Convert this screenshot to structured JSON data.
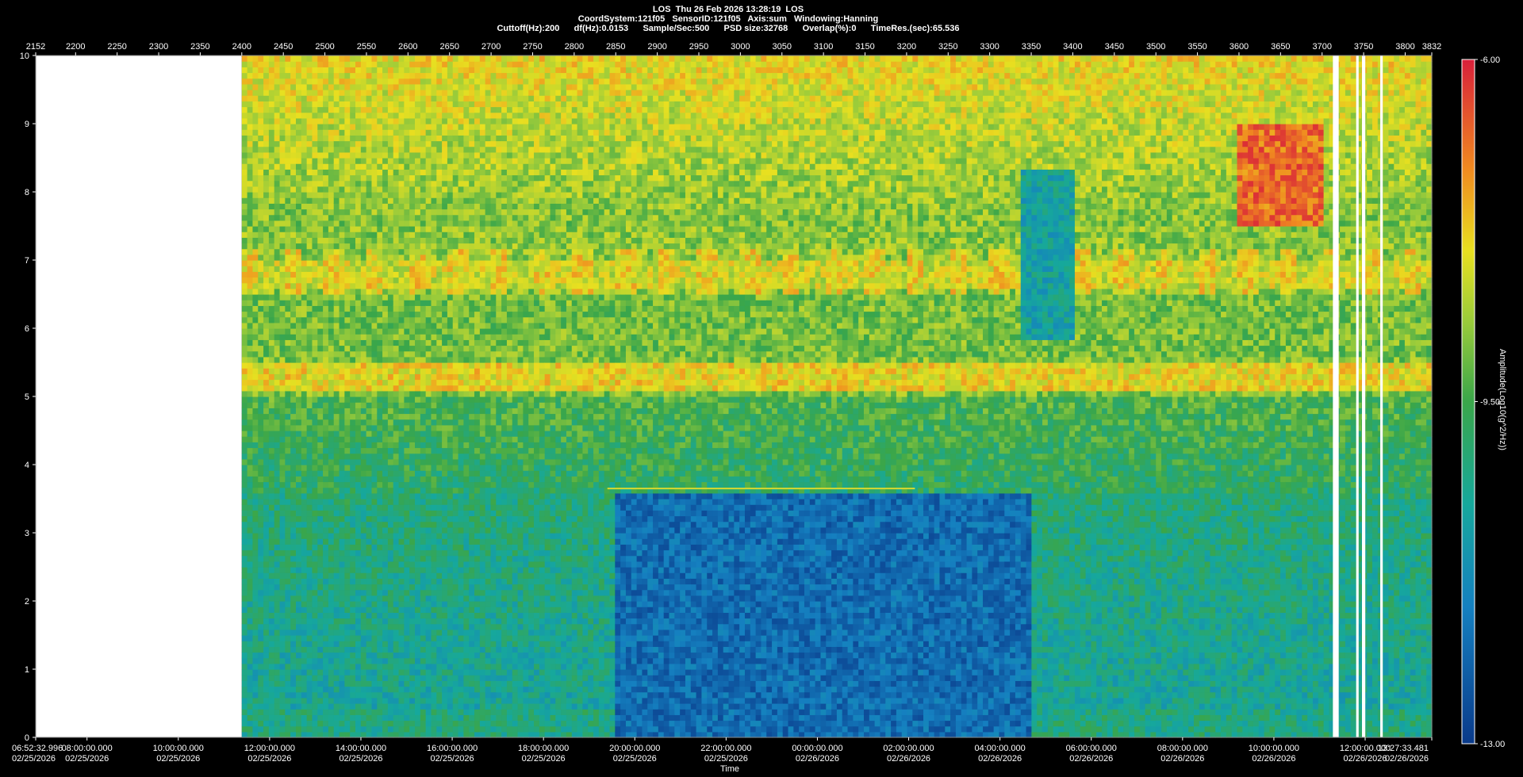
{
  "header": {
    "line1": "LOS  Thu 26 Feb 2026 13:28:19  LOS",
    "line2": "CoordSystem:121f05   SensorID:121f05   Axis:sum   Windowing:Hanning",
    "line3": "Cuttoff(Hz):200      df(Hz):0.0153      Sample/Sec:500      PSD size:32768      Overlap(%):0      TimeRes.(sec):65.536"
  },
  "colorbar": {
    "label": "Amplitude(Log10(g^2/Hz))",
    "ticks": [
      "-6.00",
      "-9.50",
      "-13.00"
    ]
  },
  "chart_data": {
    "type": "heatmap",
    "title": "",
    "xlabel": "Time",
    "ylabel": "",
    "ylim": [
      0,
      10
    ],
    "y_ticks": [
      "0",
      "1",
      "2",
      "3",
      "4",
      "5",
      "6",
      "7",
      "8",
      "9",
      "10"
    ],
    "top_axis_ticks": [
      "2152",
      "2200",
      "2250",
      "2300",
      "2350",
      "2400",
      "2450",
      "2500",
      "2550",
      "2600",
      "2650",
      "2700",
      "2750",
      "2800",
      "2850",
      "2900",
      "2950",
      "3000",
      "3050",
      "3100",
      "3150",
      "3200",
      "3250",
      "3300",
      "3350",
      "3400",
      "3450",
      "3500",
      "3550",
      "3600",
      "3650",
      "3700",
      "3750",
      "3800",
      "3832"
    ],
    "top_axis_range": [
      2152,
      3832
    ],
    "bottom_axis_ticks": [
      {
        "time": "06:52:32.996",
        "date": "02/25/2026"
      },
      {
        "time": "08:00:00.000",
        "date": "02/25/2026"
      },
      {
        "time": "10:00:00.000",
        "date": "02/25/2026"
      },
      {
        "time": "12:00:00.000",
        "date": "02/25/2026"
      },
      {
        "time": "14:00:00.000",
        "date": "02/25/2026"
      },
      {
        "time": "16:00:00.000",
        "date": "02/25/2026"
      },
      {
        "time": "18:00:00.000",
        "date": "02/25/2026"
      },
      {
        "time": "20:00:00.000",
        "date": "02/25/2026"
      },
      {
        "time": "22:00:00.000",
        "date": "02/25/2026"
      },
      {
        "time": "00:00:00.000",
        "date": "02/26/2026"
      },
      {
        "time": "02:00:00.000",
        "date": "02/26/2026"
      },
      {
        "time": "04:00:00.000",
        "date": "02/26/2026"
      },
      {
        "time": "06:00:00.000",
        "date": "02/26/2026"
      },
      {
        "time": "08:00:00.000",
        "date": "02/26/2026"
      },
      {
        "time": "10:00:00.000",
        "date": "02/26/2026"
      },
      {
        "time": "12:00:00.000",
        "date": "02/26/2026"
      },
      {
        "time": "13:27:33.481",
        "date": "02/26/2026"
      }
    ],
    "color_range": [
      -13.0,
      -6.0
    ],
    "data_start_record": 2400,
    "gaps_records": [
      [
        3713,
        3720
      ],
      [
        3741,
        3744
      ],
      [
        3748,
        3752
      ],
      [
        3770,
        3773
      ]
    ],
    "features": [
      {
        "description": "horizontal band",
        "freq_hz": 5.3,
        "value": -7.5
      },
      {
        "description": "periodic peaks",
        "freq_hz": 6.8,
        "value": -7.8
      },
      {
        "description": "high energy region",
        "freq_hz_range": [
          7.5,
          9.0
        ],
        "time_records": [
          3600,
          3700
        ],
        "value": -6.8
      },
      {
        "description": "horizontal line",
        "freq_hz": 3.65,
        "time_records": [
          2840,
          3210
        ],
        "value": -9.0
      },
      {
        "description": "low energy region",
        "freq_hz_range": [
          0,
          3.6
        ],
        "time_records": [
          2850,
          3350
        ],
        "value": -12.0
      }
    ]
  }
}
